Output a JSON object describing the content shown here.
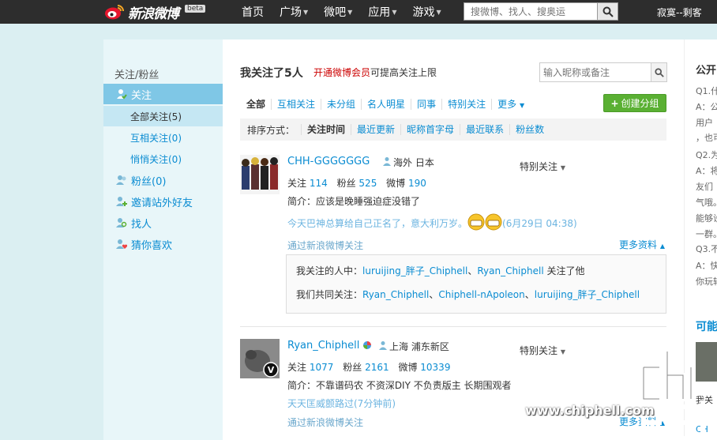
{
  "topbar": {
    "logo_text": "新浪微博",
    "beta": "beta",
    "nav": [
      {
        "label": "首页",
        "has_caret": false
      },
      {
        "label": "广场",
        "has_caret": true
      },
      {
        "label": "微吧",
        "has_caret": true
      },
      {
        "label": "应用",
        "has_caret": true
      },
      {
        "label": "游戏",
        "has_caret": true
      }
    ],
    "search_placeholder": "搜微博、找人、搜奥运",
    "user_name": "寂寞--剩客"
  },
  "sidebar": {
    "title": "关注/粉丝",
    "follow": "关注",
    "sub_all": "全部关注(5)",
    "sub_mutual": "互相关注(0)",
    "sub_secret": "悄悄关注(0)",
    "fans": "粉丝(0)",
    "invite": "邀请站外好友",
    "find": "找人",
    "guess": "猜你喜欢"
  },
  "main": {
    "title": "我关注了5人",
    "vip_link": "开通微博会员",
    "vip_text": "可提高关注上限",
    "filter_placeholder": "输入昵称或备注",
    "tabs": [
      "全部",
      "互相关注",
      "未分组",
      "名人明星",
      "同事",
      "特别关注",
      "更多"
    ],
    "create_group": "创建分组",
    "sort_label": "排序方式：",
    "sort_items": [
      "关注时间",
      "最近更新",
      "昵称首字母",
      "最近联系",
      "粉丝数"
    ]
  },
  "users": [
    {
      "name": "CHH-GGGGGGG",
      "location": "海外 日本",
      "follow_label": "关注",
      "follow": "114",
      "fans_label": "粉丝",
      "fans": "525",
      "weibo_label": "微博",
      "weibo": "190",
      "intro": "简介：应该是晚睡强迫症没错了",
      "last_post": "今天巴神总算给自己正名了，意大利万岁。",
      "last_time": "(6月29日 04:38)",
      "via": "通过新浪微博关注",
      "special": "特别关注",
      "more": "更多资料"
    },
    {
      "name": "Ryan_Chiphell",
      "location": "上海 浦东新区",
      "follow_label": "关注",
      "follow": "1077",
      "fans_label": "粉丝",
      "fans": "2161",
      "weibo_label": "微博",
      "weibo": "10339",
      "intro": "简介：不靠谱码农 不资深DIY 不负责版主 长期围观者",
      "last_post": "天天匡威颤路过(7分钟前)",
      "via": "通过新浪微博关注",
      "special": "特别关注",
      "more": "更多资料"
    }
  ],
  "relation": {
    "line1_prefix": "我关注的人中：",
    "line1_a": "luruijing_胖子_Chiphell",
    "line1_sep": "、",
    "line1_b": "Ryan_Chiphell",
    "line1_suffix": " 关注了他",
    "line2_prefix": "我们共同关注：",
    "line2_a": "Ryan_Chiphell",
    "line2_b": "Chiphell-nApoleon",
    "line2_c": "luruijing_胖子_Chiphell"
  },
  "right": {
    "title": "公开",
    "lines": [
      "Q1.什",
      "A：公",
      "用户",
      "，也可",
      "Q2.为",
      "A：将",
      "友们",
      "气哦。",
      "能够设",
      "一群。",
      "Q3.不",
      "A：快",
      "你玩转"
    ],
    "title2": "可能",
    "bottom1": "我关",
    "bottom2": "CH"
  },
  "watermark": {
    "url": "www.chiphell.com"
  },
  "colors": {
    "topbar": "#2d2d2d",
    "background": "#dbeff2",
    "link": "#0a8cd2",
    "sidebar_active": "#7fc7e6",
    "create_button": "#5ab033"
  }
}
